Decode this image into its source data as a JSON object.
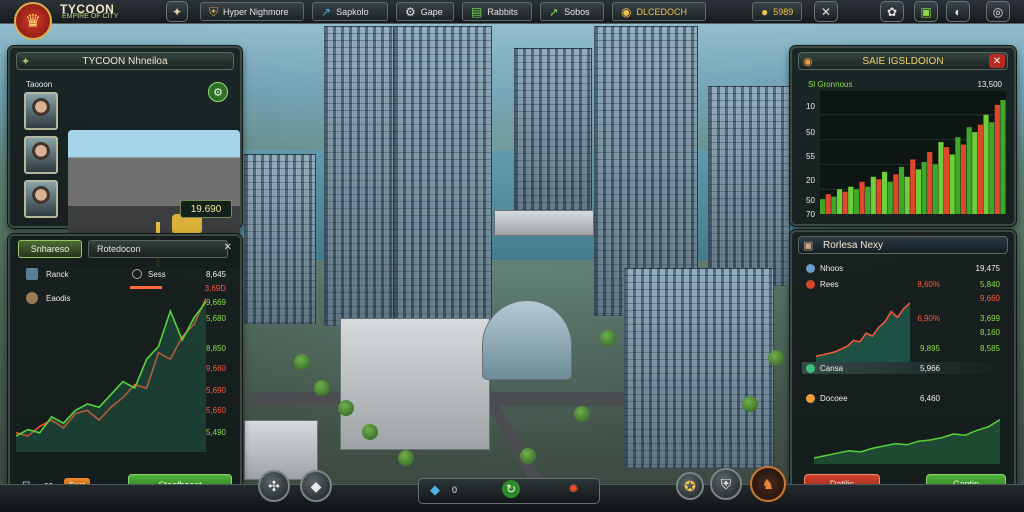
{
  "brand": {
    "title": "TYCOON",
    "subtitle": "EMPIRE OF CITY",
    "logo_icon": "crown-icon"
  },
  "topbar": {
    "items": [
      {
        "label": "Hyper Nighmore",
        "icon": "shield-icon",
        "glyph": "⛨"
      },
      {
        "label": "Sapkolo",
        "icon": "trend-icon",
        "glyph": "↗"
      },
      {
        "label": "Gape",
        "icon": "gear-icon",
        "glyph": "⚙"
      },
      {
        "label": "Rabbits",
        "icon": "chart-icon",
        "glyph": "▤"
      },
      {
        "label": "Sobos",
        "icon": "arrow-up-icon",
        "glyph": "➚"
      },
      {
        "label": "DLCEDOCH",
        "icon": "coin-icon",
        "glyph": "◉"
      },
      {
        "label": "5989",
        "icon": "gold-icon",
        "glyph": "●"
      }
    ],
    "close_glyph": "✕",
    "right_buttons": [
      {
        "icon": "settings-icon",
        "glyph": "✿"
      },
      {
        "icon": "map-icon",
        "glyph": "▣"
      },
      {
        "icon": "profile-icon",
        "glyph": "◐"
      },
      {
        "icon": "chat-icon",
        "glyph": "◎"
      }
    ],
    "leaf_glyph": "✦"
  },
  "left_top": {
    "title": "TYCOON Nhneiloa",
    "icon": "shield-icon",
    "tag": "Taooon",
    "money": "19.690",
    "badge": "⚙"
  },
  "left_bottom": {
    "tab_active": "Snhareso",
    "tab_inactive": "Rotedocon",
    "rows": [
      {
        "label": "Ranck",
        "icon": "person-icon"
      },
      {
        "label": "Eaodis",
        "icon": "brain-icon"
      }
    ],
    "sub_label": "Sess",
    "values": [
      {
        "text": "8,645",
        "c": "w"
      },
      {
        "text": "3,69D",
        "c": "r"
      },
      {
        "text": "9,669",
        "c": "g"
      },
      {
        "text": "5,680",
        "c": "g"
      },
      {
        "text": "8,850",
        "c": "g"
      },
      {
        "text": "9,660",
        "c": "r"
      },
      {
        "text": "5,690",
        "c": "r"
      },
      {
        "text": "5,660",
        "c": "r"
      },
      {
        "text": "5,490",
        "c": "g"
      }
    ],
    "footer_count": "32",
    "footer_tag": "Fost",
    "button": "Staefhecot"
  },
  "right_top": {
    "title": "SAIE IGSLDOION",
    "subtitle": "Sl Gronnous",
    "value": "13,500",
    "y_ticks": [
      "10",
      "50",
      "55",
      "20",
      "50",
      "70"
    ]
  },
  "right_bottom": {
    "title": "Rorlesa Nexy",
    "rows": [
      {
        "label": "Nhoos",
        "total": "19,475"
      },
      {
        "label": "Rees"
      }
    ],
    "values": [
      {
        "text": "8,60%",
        "c": "r"
      },
      {
        "text": "5,840",
        "c": "g"
      },
      {
        "text": "9,660",
        "c": "r"
      },
      {
        "text": "6,90%",
        "c": "r"
      },
      {
        "text": "3,699",
        "c": "g"
      },
      {
        "text": "8,160",
        "c": "g"
      },
      {
        "text": "9,895",
        "c": "g"
      },
      {
        "text": "8,585",
        "c": "g"
      }
    ],
    "mid_rows": [
      {
        "label": "Cansa",
        "value": "5,966"
      },
      {
        "label": "Docoee",
        "value": "6,460"
      }
    ],
    "btn_left": "Datilis",
    "btn_right": "Cantin"
  },
  "bottom": {
    "left_buttons": [
      {
        "icon": "fan-icon",
        "glyph": "✣"
      },
      {
        "icon": "crystal-icon",
        "glyph": "◆"
      }
    ],
    "center": [
      {
        "icon": "gem-icon",
        "glyph": "◆",
        "value": "0"
      },
      {
        "icon": "refresh-icon",
        "glyph": "↻"
      },
      {
        "icon": "fire-icon",
        "glyph": "✹"
      }
    ],
    "right_buttons": [
      {
        "icon": "trophy-icon",
        "glyph": "✪"
      },
      {
        "icon": "armor-icon",
        "glyph": "⛨"
      },
      {
        "icon": "emblem-icon",
        "glyph": "♞"
      }
    ]
  },
  "chart_data": [
    {
      "type": "line",
      "title": "",
      "series": [
        {
          "name": "",
          "color": "#ff4c2c",
          "values": [
            12,
            10,
            16,
            20,
            15,
            24,
            26,
            20,
            28,
            34,
            42,
            40,
            62,
            58,
            72,
            80,
            96
          ]
        },
        {
          "name": "",
          "color": "#58d23a",
          "values": [
            10,
            14,
            12,
            22,
            18,
            26,
            30,
            28,
            36,
            44,
            40,
            58,
            66,
            88,
            70,
            84,
            94
          ]
        }
      ]
    },
    {
      "type": "bar",
      "title": "",
      "ylabel": "",
      "ylim": [
        0,
        100
      ],
      "values": [
        12,
        16,
        14,
        20,
        18,
        22,
        20,
        26,
        22,
        30,
        28,
        34,
        26,
        32,
        38,
        30,
        44,
        36,
        42,
        50,
        40,
        58,
        54,
        48,
        62,
        56,
        70,
        66,
        72,
        80,
        74,
        88,
        92
      ]
    },
    {
      "type": "area",
      "values": [
        8,
        10,
        12,
        14,
        18,
        22,
        30,
        28,
        40,
        36,
        48,
        56,
        70,
        62,
        74,
        82
      ]
    },
    {
      "type": "area",
      "values": [
        10,
        14,
        18,
        22,
        20,
        26,
        30,
        34,
        32,
        38,
        40,
        44,
        50,
        48,
        56,
        62,
        74
      ]
    }
  ]
}
